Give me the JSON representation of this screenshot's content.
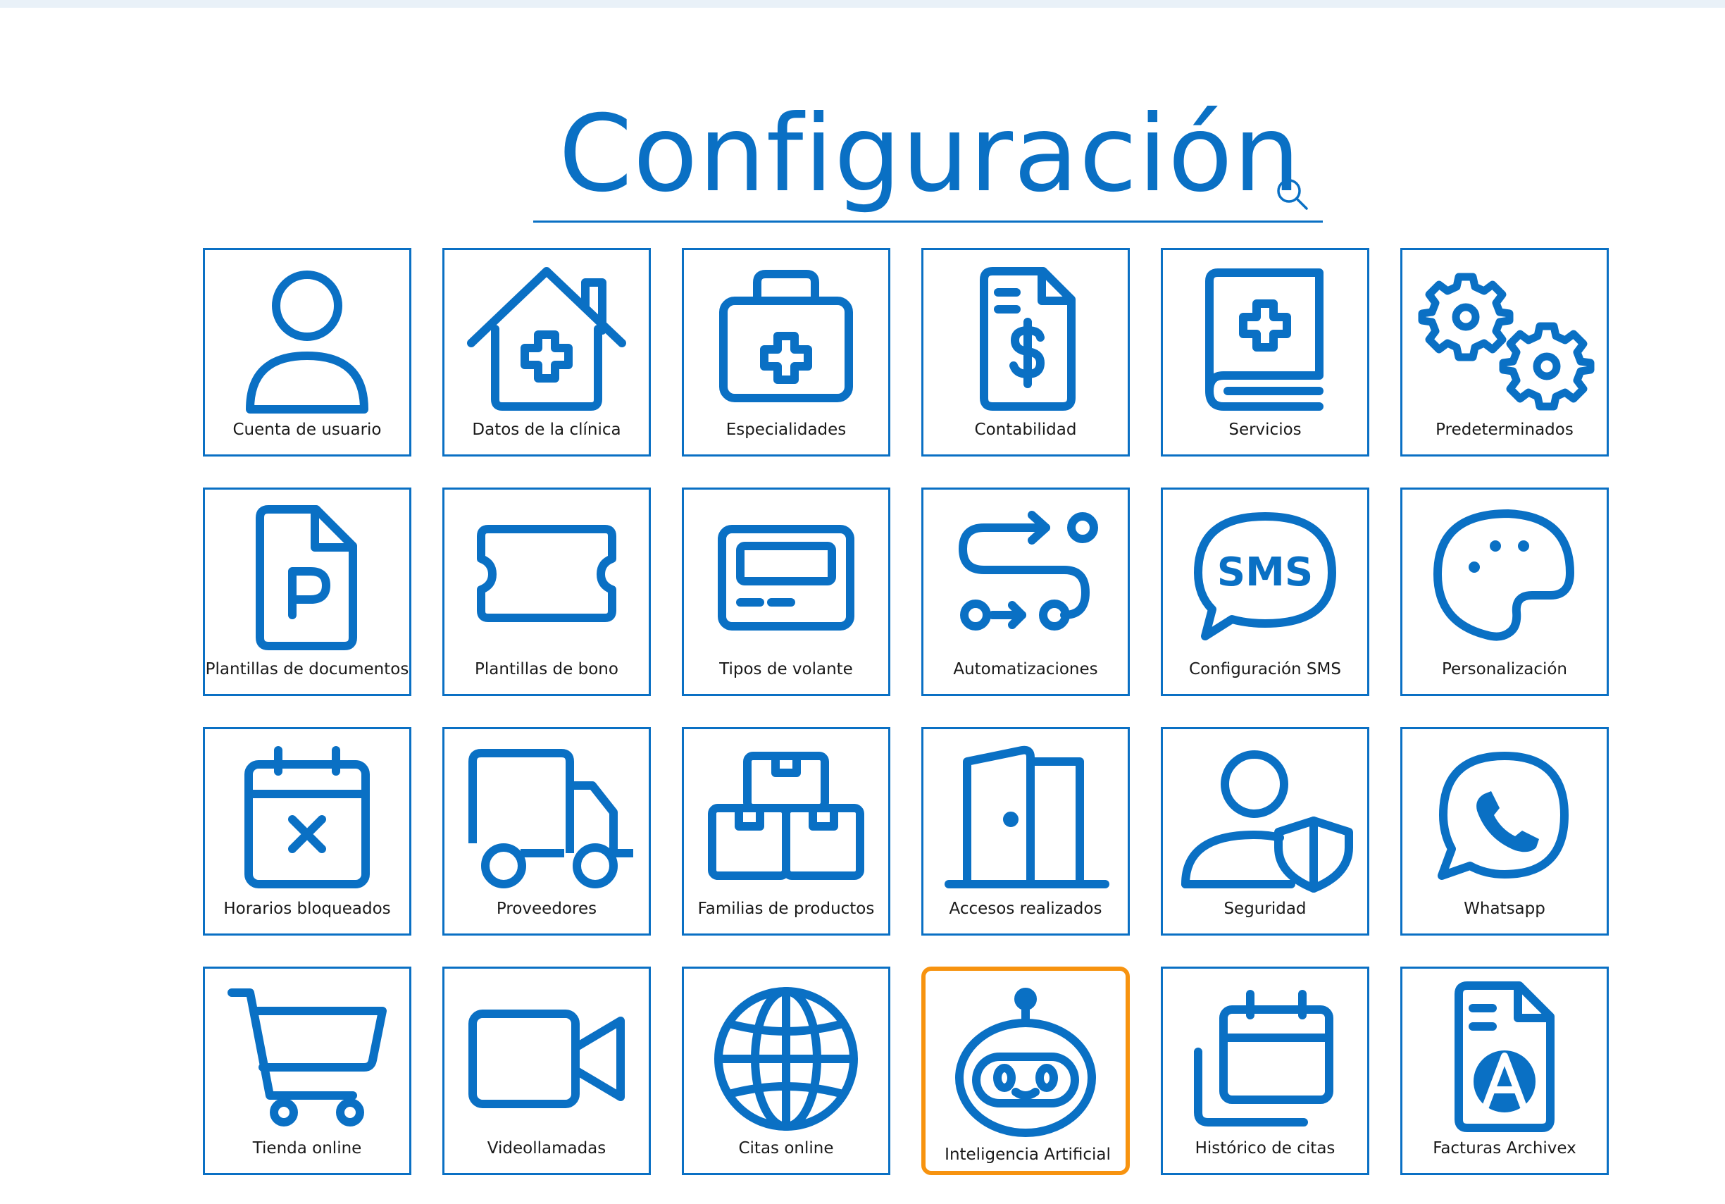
{
  "page": {
    "title": "Configuración",
    "accent_color": "#0a70c4",
    "highlight_color": "#f7930f"
  },
  "search": {
    "value": "",
    "placeholder": "",
    "icon": "search-icon"
  },
  "tiles": [
    {
      "label": "Cuenta de usuario",
      "icon": "user-icon"
    },
    {
      "label": "Datos de la clínica",
      "icon": "clinic-house-icon"
    },
    {
      "label": "Especialidades",
      "icon": "medical-kit-icon"
    },
    {
      "label": "Contabilidad",
      "icon": "invoice-dollar-icon"
    },
    {
      "label": "Servicios",
      "icon": "medical-book-icon"
    },
    {
      "label": "Predeterminados",
      "icon": "gears-icon"
    },
    {
      "label": "Plantillas de documentos",
      "icon": "document-p-icon"
    },
    {
      "label": "Plantillas de bono",
      "icon": "ticket-icon"
    },
    {
      "label": "Tipos de volante",
      "icon": "voucher-card-icon"
    },
    {
      "label": "Automatizaciones",
      "icon": "workflow-icon"
    },
    {
      "label": "Configuración SMS",
      "icon": "sms-bubble-icon"
    },
    {
      "label": "Personalización",
      "icon": "palette-icon"
    },
    {
      "label": "Horarios bloqueados",
      "icon": "calendar-blocked-icon"
    },
    {
      "label": "Proveedores",
      "icon": "truck-icon"
    },
    {
      "label": "Familias de productos",
      "icon": "boxes-icon"
    },
    {
      "label": "Accesos realizados",
      "icon": "door-icon"
    },
    {
      "label": "Seguridad",
      "icon": "user-shield-icon"
    },
    {
      "label": "Whatsapp",
      "icon": "whatsapp-icon"
    },
    {
      "label": "Tienda online",
      "icon": "cart-icon"
    },
    {
      "label": "Videollamadas",
      "icon": "video-camera-icon"
    },
    {
      "label": "Citas online",
      "icon": "globe-icon"
    },
    {
      "label": "Inteligencia Artificial",
      "icon": "robot-icon",
      "highlighted": true
    },
    {
      "label": "Histórico de citas",
      "icon": "calendar-history-icon"
    },
    {
      "label": "Facturas Archivex",
      "icon": "archivex-invoice-icon"
    }
  ]
}
